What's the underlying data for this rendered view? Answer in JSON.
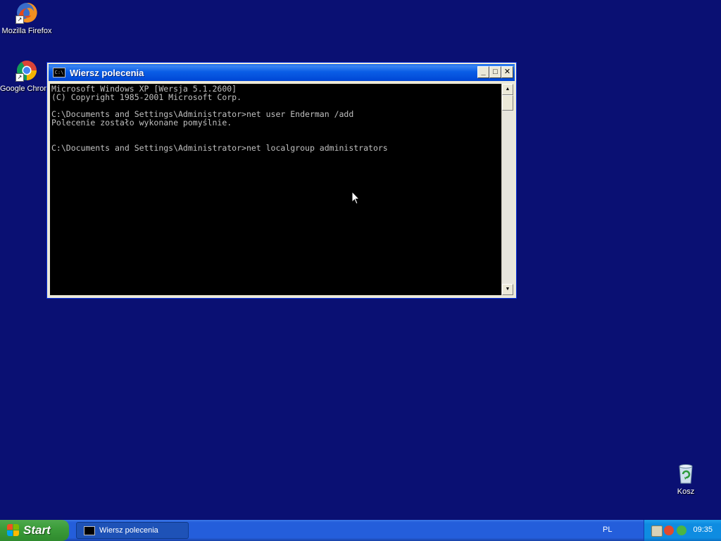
{
  "desktop": {
    "icons": [
      {
        "name": "firefox",
        "label": "Mozilla Firefox"
      },
      {
        "name": "chrome",
        "label": "Google Chrome"
      },
      {
        "name": "recycle-bin",
        "label": "Kosz"
      }
    ]
  },
  "console_window": {
    "title": "Wiersz polecenia",
    "icon_text": "C:\\",
    "lines": [
      "Microsoft Windows XP [Wersja 5.1.2600]",
      "(C) Copyright 1985-2001 Microsoft Corp.",
      "",
      "C:\\Documents and Settings\\Administrator>net user Enderman /add",
      "Polecenie zostało wykonane pomyślnie.",
      "",
      "",
      "C:\\Documents and Settings\\Administrator>net localgroup administrators"
    ],
    "buttons": {
      "minimize": "_",
      "maximize": "□",
      "close": "✕"
    }
  },
  "taskbar": {
    "start_label": "Start",
    "tasks": [
      {
        "label": "Wiersz polecenia",
        "icon": "cmd-icon"
      }
    ],
    "language": "PL",
    "clock": "09:35"
  },
  "colors": {
    "desktop_bg": "#0a1073",
    "console_bg": "#000000",
    "console_fg": "#c0c0c0",
    "title_bar": "#0a5ee6",
    "taskbar": "#245edb",
    "start_button": "#3c9d3a",
    "tray": "#0e8ce1"
  }
}
